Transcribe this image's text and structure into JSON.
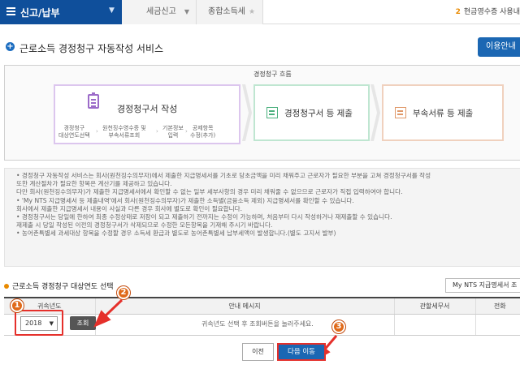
{
  "topbar": {
    "home_label": "신고/납부",
    "crumb1": "세금신고",
    "crumb2": "종합소득세",
    "right_badge": "2",
    "right_text": "현금영수증 사용내"
  },
  "page_title": "근로소득 경정청구 자동작성 서비스",
  "guide_button": "이용안내",
  "flow": {
    "title": "경정청구 흐름",
    "step1": {
      "name": "경정청구서 작성",
      "subs": [
        "경정청구\n대상연도선택",
        "원천징수영수증 및\n부속서류조회",
        "기본정보\n입력",
        "공제항목\n수정(추가)"
      ]
    },
    "step2": {
      "name": "경정청구서 등 제출"
    },
    "step3": {
      "name": "부속서류 등 제출"
    }
  },
  "notes": [
    "• 경정청구 자동작성 서비스는 회사(원천징수의무자)에서 제출한 지급명세서를 기초로 당초금액을 미리 채워주고 근로자가 필요한 부분을 고쳐 경정청구서를 작성",
    "  또한 계산절차가 필요한 항목은 계산기를 제공하고 있습니다.",
    "  다만 회사(원천징수의무자)가 제출한 지급명세서에서 확인할 수 없는 일부 세부사항의 경우 미리 채워줄 수 없으므로 근로자가 직접 입력하여야 합니다.",
    "• 'My NTS 지급명세서 등 제출내역'에서 회사(원천징수의무자)가 제출한 소득별(금융소득 제외) 지급명세서를 확인할 수 있습니다.",
    "  회사에서 제출한 지급명세서 내용이 사실과 다른 경우 회사에 별도로 확인이 필요합니다.",
    "• 경정청구서는 당일에 한하여 최종 수정상태로 저장이 되고 제출하기 전까지는 수정이 가능하며, 처음부터 다시 작성하거나 재제출할 수 있습니다.",
    "  재제출 시 당일 작성된 이전의 경정청구서가 삭제되므로 수정한 모든항목을 기재해 주시기 바랍니다.",
    "• 농어촌특별세 과세대상 항목을 수정할 경우 소득세 환급과 별도로 농어촌특별세 납부세액이 발생합니다.(별도 고지서 발부)"
  ],
  "section2": {
    "title": "근로소득 경정청구 대상연도 선택",
    "mynts_button": "My NTS 지급명세서 조",
    "headers": [
      "귀속년도",
      "안내 메시지",
      "관할세무서",
      "전화"
    ],
    "selected_year": "2018",
    "query_button": "조회",
    "message": "귀속년도 선택 후 조회버튼을 눌러주세요."
  },
  "annotations": [
    "1",
    "2",
    "3"
  ],
  "buttons": {
    "prev": "이전",
    "next": "다음 이동"
  },
  "colors": {
    "brand": "#0f4f9b",
    "accent_blue": "#1b67b3",
    "annotation_red": "#e5302b",
    "annotation_orange": "#e06a1a"
  }
}
